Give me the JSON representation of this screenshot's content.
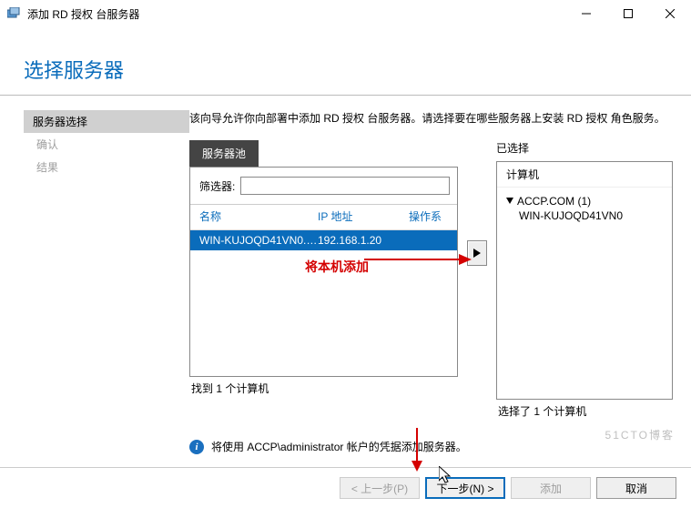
{
  "title_bar": {
    "title": "添加 RD 授权 台服务器"
  },
  "heading": "选择服务器",
  "sidebar": {
    "items": [
      {
        "label": "服务器选择"
      },
      {
        "label": "确认"
      },
      {
        "label": "结果"
      }
    ]
  },
  "main": {
    "description": "该向导允许你向部署中添加 RD 授权 台服务器。请选择要在哪些服务器上安装 RD 授权 角色服务。",
    "pool_tab": "服务器池",
    "filter_label": "筛选器:",
    "filter_value": "",
    "columns": {
      "name": "名称",
      "ip": "IP 地址",
      "os": "操作系"
    },
    "rows": [
      {
        "name": "WIN-KUJOQD41VN0.a...",
        "ip": "192.168.1.20"
      }
    ],
    "found_count": "找到 1 个计算机",
    "selected_title": "已选择",
    "selected_header": "计算机",
    "selected_tree": {
      "parent": "ACCP.COM (1)",
      "child": "WIN-KUJOQD41VN0"
    },
    "selected_count": "选择了 1 个计算机",
    "info_text": "将使用 ACCP\\administrator 帐户的凭据添加服务器。"
  },
  "footer": {
    "prev": "< 上一步(P)",
    "next": "下一步(N) >",
    "add": "添加",
    "cancel": "取消"
  },
  "annotation": {
    "add_local": "将本机添加"
  },
  "watermark": "51CTO博客"
}
